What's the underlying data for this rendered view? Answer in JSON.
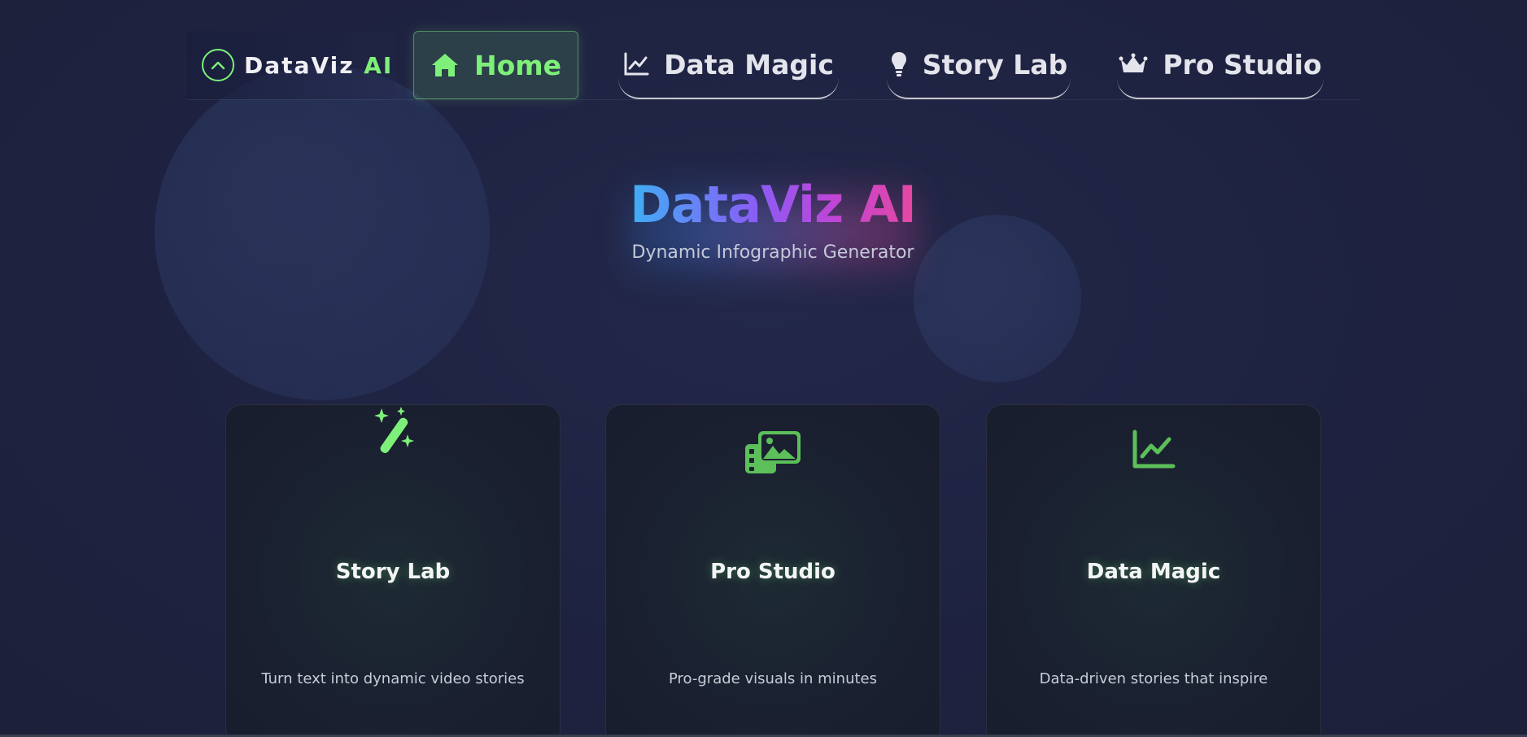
{
  "logo": {
    "name": "DataViz",
    "suffix": "AI"
  },
  "nav": {
    "items": [
      {
        "label": "Home",
        "icon": "home-icon",
        "active": true
      },
      {
        "label": "Data Magic",
        "icon": "chart-line-icon"
      },
      {
        "label": "Story Lab",
        "icon": "lightbulb-icon"
      },
      {
        "label": "Pro Studio",
        "icon": "crown-icon"
      }
    ]
  },
  "hero": {
    "title": "DataViz AI",
    "subtitle": "Dynamic Infographic Generator"
  },
  "cards": [
    {
      "title": "Story Lab",
      "description": "Turn text into dynamic video stories",
      "icon": "magic-wand-icon"
    },
    {
      "title": "Pro Studio",
      "description": "Pro-grade visuals in minutes",
      "icon": "photo-film-icon"
    },
    {
      "title": "Data Magic",
      "description": "Data-driven stories that inspire",
      "icon": "chart-line-icon"
    }
  ],
  "colors": {
    "accent": "#7ef07a",
    "background": "#1f2340",
    "gradient_start": "#38b6f5",
    "gradient_end": "#ec4899"
  }
}
